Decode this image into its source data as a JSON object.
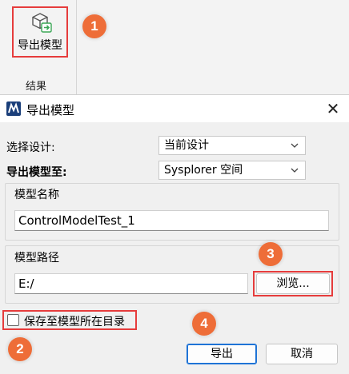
{
  "ribbon": {
    "export_button_label": "导出模型",
    "group_label": "结果"
  },
  "badges": [
    "1",
    "2",
    "3",
    "4"
  ],
  "dialog": {
    "title": "导出模型",
    "close_glyph": "✕",
    "select_design_label": "选择设计:",
    "select_design_value": "当前设计",
    "export_to_label": "导出模型至:",
    "export_to_value": "Sysplorer 空间",
    "model_name_group": "模型名称",
    "model_name_value": "ControlModelTest_1",
    "model_path_group": "模型路径",
    "model_path_value": "E:/",
    "browse_label": "浏览...",
    "save_to_dir_label": "保存至模型所在目录",
    "save_to_dir_checked": false,
    "export_label": "导出",
    "cancel_label": "取消"
  },
  "colors": {
    "accent_red": "#e63c3c",
    "badge_orange": "#ee6d38",
    "primary_blue": "#1e73d6"
  }
}
